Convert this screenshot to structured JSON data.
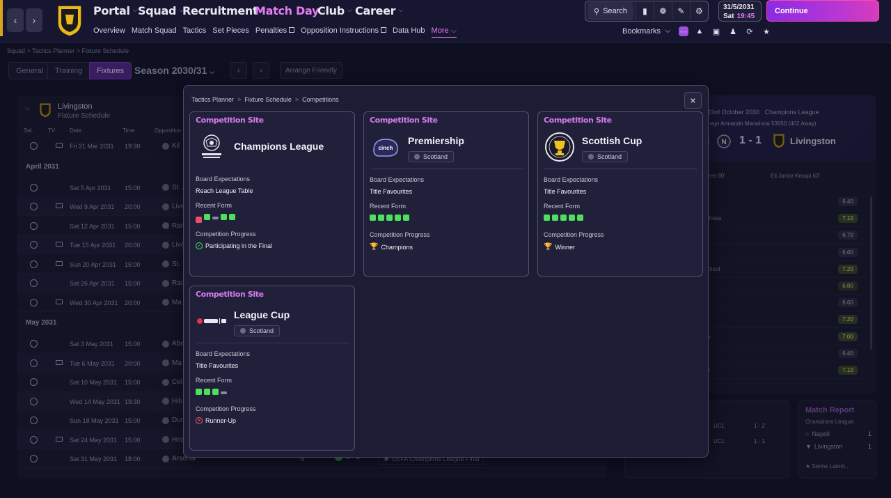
{
  "topbar": {
    "nav": [
      {
        "label": "Portal"
      },
      {
        "label": "Squad"
      },
      {
        "label": "Recruitment"
      },
      {
        "label": "Match Day"
      },
      {
        "label": "Club"
      },
      {
        "label": "Career"
      }
    ],
    "subnav": [
      "Overview",
      "Match Squad",
      "Tactics",
      "Set Pieces",
      "Penalties",
      "Opposition Instructions",
      "Data Hub",
      "More"
    ],
    "search_label": "Search",
    "date": "31/5/2031",
    "day": "Sat",
    "time": "19:45",
    "continue_label": "Continue",
    "bookmarks_label": "Bookmarks",
    "accent_color": "#e47cf2"
  },
  "breadcrumb": [
    "Squad",
    "Tactics Planner",
    "Fixture Schedule"
  ],
  "tabs": [
    "General",
    "Training",
    "Fixtures"
  ],
  "season_label": "Season 2030/31",
  "arrange_friendly_label": "Arrange Friendly",
  "fixture_list": {
    "club": "Livingston",
    "subtitle": "Fixture Schedule",
    "columns": [
      "Sel.",
      "TV",
      "Date",
      "Time",
      "Opposition"
    ],
    "rows": [
      {
        "date": "Fri 21 Mar 2031",
        "time": "19:30",
        "opp": "Kil",
        "tv": true
      },
      {
        "month": "April 2031"
      },
      {
        "date": "Sat 5 Apr 2031",
        "time": "15:00",
        "opp": "St. J",
        "tv": false
      },
      {
        "date": "Wed 9 Apr 2031",
        "time": "20:00",
        "opp": "Live",
        "tv": true
      },
      {
        "date": "Sat 12 Apr 2031",
        "time": "15:00",
        "opp": "Ran",
        "tv": false
      },
      {
        "date": "Tue 15 Apr 2031",
        "time": "20:00",
        "opp": "Live",
        "tv": true
      },
      {
        "date": "Sun 20 Apr 2031",
        "time": "15:00",
        "opp": "St. I",
        "tv": true
      },
      {
        "date": "Sat 26 Apr 2031",
        "time": "15:00",
        "opp": "Ran",
        "tv": false
      },
      {
        "date": "Wed 30 Apr 2031",
        "time": "20:00",
        "opp": "Ma",
        "tv": true
      },
      {
        "month": "May 2031"
      },
      {
        "date": "Sat 3 May 2031",
        "time": "15:00",
        "opp": "Abe",
        "tv": false
      },
      {
        "date": "Tue 6 May 2031",
        "time": "20:00",
        "opp": "Ma",
        "tv": true
      },
      {
        "date": "Sat 10 May 2031",
        "time": "15:00",
        "opp": "Cel",
        "tv": false
      },
      {
        "date": "Wed 14 May 2031",
        "time": "19:30",
        "opp": "Hib",
        "tv": false
      },
      {
        "date": "Sun 18 May 2031",
        "time": "15:00",
        "opp": "Dur",
        "tv": false
      },
      {
        "date": "Sat 24 May 2031",
        "time": "15:00",
        "opp": "Hea",
        "tv": true
      },
      {
        "date": "Sat 31 May 2031",
        "time": "18:00",
        "opp": "Arsenal",
        "tv": false,
        "venue": "N",
        "result": "3 - 2",
        "comp": "UEFA Champions League Final"
      }
    ]
  },
  "match_panel": {
    "info1": "23rd October 2030",
    "info1b": "Champions League",
    "info2": "ego Armando Maradona  53650 (402 Away)",
    "home": "li",
    "score": "1 - 1",
    "away": "Livingston",
    "scorer1": "ens 90'",
    "scorer2": "Eli Junior Kroupi 63'",
    "ratings": [
      {
        "name": "",
        "value": "6.40",
        "tone": "plain"
      },
      {
        "name": "drosa",
        "value": "7.10",
        "tone": "hi"
      },
      {
        "name": "",
        "value": "6.70",
        "tone": "plain"
      },
      {
        "name": "",
        "value": "6.60",
        "tone": "plain"
      },
      {
        "name": "Diouf",
        "value": "7.20",
        "tone": "hi"
      },
      {
        "name": "",
        "value": "6.80",
        "tone": "mid"
      },
      {
        "name": "",
        "value": "6.60",
        "tone": "plain"
      },
      {
        "name": "",
        "value": "7.20",
        "tone": "hi"
      },
      {
        "name": "o",
        "value": "7.00",
        "tone": "hi"
      },
      {
        "name": "",
        "value": "6.40",
        "tone": "plain"
      },
      {
        "name": "s",
        "value": "7.10",
        "tone": "hi"
      }
    ]
  },
  "recent_results": [
    {
      "comp": "UCL",
      "score": "1 - 2"
    },
    {
      "comp": "UCL",
      "score": "1 - 1"
    }
  ],
  "match_report": {
    "title": "Match Report",
    "competition": "Champions League",
    "teams": [
      {
        "name": "Napoli",
        "goals": "1"
      },
      {
        "name": "Livingston",
        "goals": "1"
      }
    ],
    "player": "Senne Lamm..."
  },
  "modal": {
    "breadcrumb": [
      "Tactics Planner",
      "Fixture Schedule",
      "Competitions"
    ],
    "close_label": "×",
    "cards": [
      {
        "site_label": "Competition Site",
        "name": "Champions League",
        "nation": "",
        "expectations_label": "Board Expectations",
        "expectations": "Reach League Table",
        "form_label": "Recent Form",
        "form": [
          "L",
          "W",
          "D",
          "W",
          "W"
        ],
        "progress_label": "Competition Progress",
        "progress": "Participating in the Final",
        "progress_icon": "check-icon",
        "logo": "champions-league-logo"
      },
      {
        "site_label": "Competition Site",
        "name": "Premiership",
        "nation": "Scotland",
        "expectations_label": "Board Expectations",
        "expectations": "Title Favourites",
        "form_label": "Recent Form",
        "form": [
          "W",
          "W",
          "W",
          "W",
          "W"
        ],
        "progress_label": "Competition Progress",
        "progress": "Champions",
        "progress_icon": "trophy-icon",
        "logo": "premiership-logo"
      },
      {
        "site_label": "Competition Site",
        "name": "Scottish Cup",
        "nation": "Scotland",
        "expectations_label": "Board Expectations",
        "expectations": "Title Favourites",
        "form_label": "Recent Form",
        "form": [
          "W",
          "W",
          "W",
          "W",
          "W"
        ],
        "progress_label": "Competition Progress",
        "progress": "Winner",
        "progress_icon": "trophy-icon",
        "logo": "scottish-cup-logo"
      },
      {
        "site_label": "Competition Site",
        "name": "League Cup",
        "nation": "Scotland",
        "expectations_label": "Board Expectations",
        "expectations": "Title Favourites",
        "form_label": "Recent Form",
        "form": [
          "W",
          "W",
          "W",
          "D"
        ],
        "progress_label": "Competition Progress",
        "progress": "Runner-Up",
        "progress_icon": "cross-icon",
        "logo": "league-cup-logo"
      }
    ]
  }
}
